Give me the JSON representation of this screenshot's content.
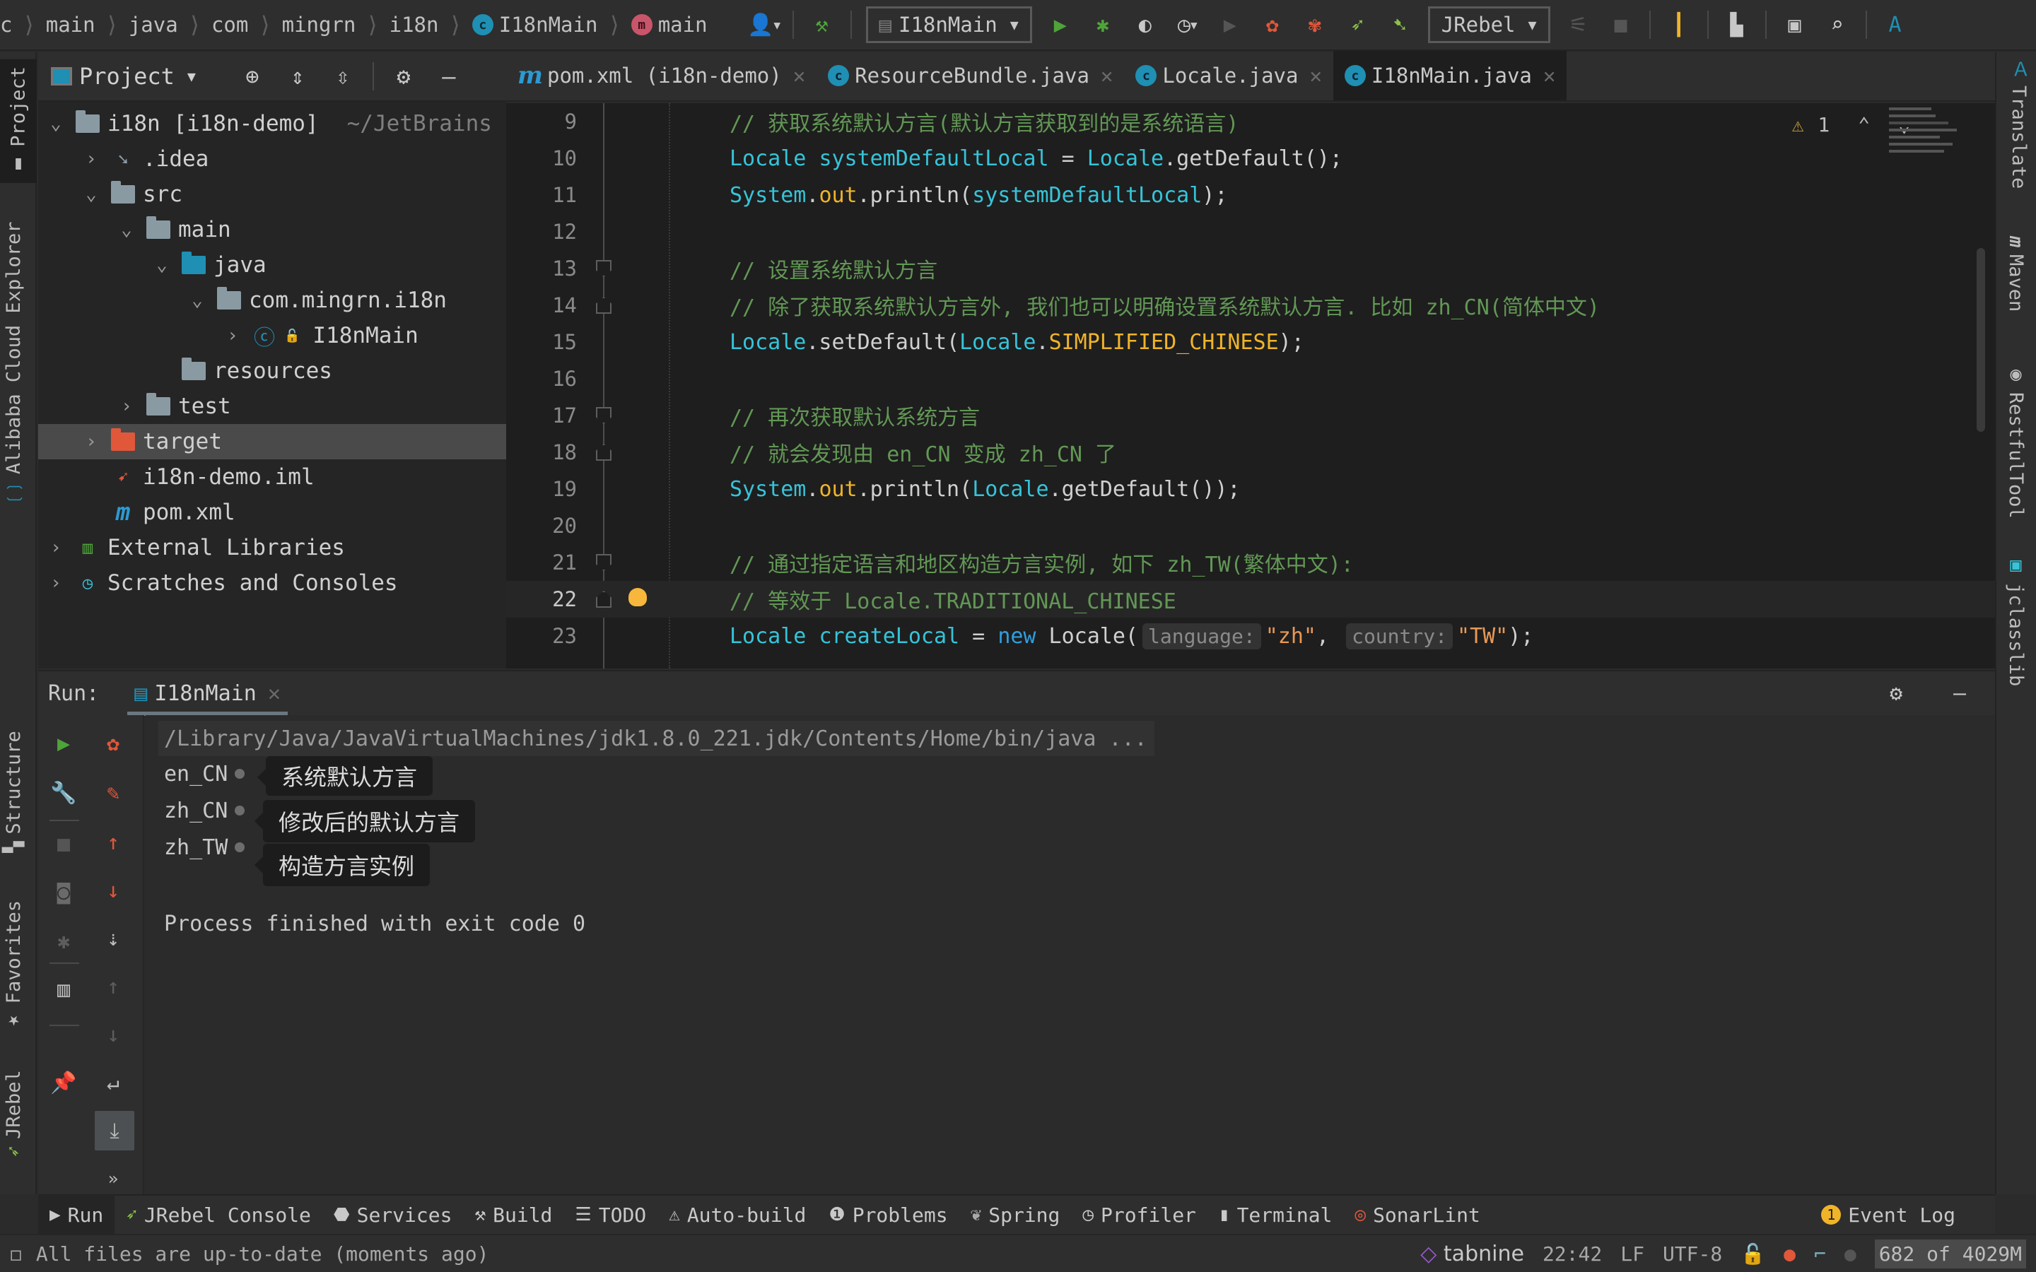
{
  "navbar": {
    "breadcrumbs": [
      "c",
      "main",
      "java",
      "com",
      "mingrn",
      "i18n",
      "I18nMain",
      "main"
    ],
    "run_config": "I18nMain",
    "jrebel_config": "JRebel",
    "icons": [
      "user-icon",
      "hammer-build-icon",
      "run-icon",
      "debug-icon",
      "coverage-icon",
      "profile-icon",
      "run-disabled-icon",
      "jrebel-run-icon",
      "jrebel-debug-icon",
      "jrebel-rocket-run-icon",
      "jrebel-rocket-debug-icon",
      "stop-icon",
      "vcs-update-icon",
      "project-structure-icon",
      "run-anything-icon",
      "search-icon",
      "translate-icon"
    ]
  },
  "left_strip": {
    "tabs": [
      {
        "label": "Project",
        "icon": "folder-icon",
        "active": true
      },
      {
        "label": "Alibaba Cloud Explorer",
        "icon": "alibaba-cloud-icon"
      },
      {
        "label": "Structure",
        "icon": "structure-icon"
      },
      {
        "label": "Favorites",
        "icon": "star-icon"
      },
      {
        "label": "JRebel",
        "icon": "jrebel-icon"
      }
    ]
  },
  "right_strip": {
    "tabs": [
      {
        "label": "Translate",
        "icon": "translate-icon"
      },
      {
        "label": "Maven",
        "icon": "maven-icon"
      },
      {
        "label": "RestfulTool",
        "icon": "restful-icon"
      },
      {
        "label": "jclasslib",
        "icon": "jclasslib-icon"
      }
    ]
  },
  "project": {
    "title": "Project",
    "tree": [
      {
        "label": "i18n [i18n-demo]",
        "hint": "~/JetBrains",
        "depth": 0,
        "expanded": true,
        "icon": "module-folder"
      },
      {
        "label": ".idea",
        "depth": 1,
        "expanded": false,
        "icon": "idea-folder"
      },
      {
        "label": "src",
        "depth": 1,
        "expanded": true,
        "icon": "folder"
      },
      {
        "label": "main",
        "depth": 2,
        "expanded": true,
        "icon": "folder"
      },
      {
        "label": "java",
        "depth": 3,
        "expanded": true,
        "icon": "source-folder"
      },
      {
        "label": "com.mingrn.i18n",
        "depth": 4,
        "expanded": true,
        "icon": "package"
      },
      {
        "label": "I18nMain",
        "depth": 5,
        "expanded": false,
        "icon": "class-main"
      },
      {
        "label": "resources",
        "depth": 3,
        "icon": "resources-folder"
      },
      {
        "label": "test",
        "depth": 2,
        "expanded": false,
        "icon": "folder"
      },
      {
        "label": "target",
        "depth": 1,
        "expanded": false,
        "icon": "excluded-folder",
        "selected": true
      },
      {
        "label": "i18n-demo.iml",
        "depth": 1,
        "icon": "iml-file"
      },
      {
        "label": "pom.xml",
        "depth": 1,
        "icon": "maven-file"
      },
      {
        "label": "External Libraries",
        "depth": 0,
        "expanded": false,
        "icon": "libraries"
      },
      {
        "label": "Scratches and Consoles",
        "depth": 0,
        "expanded": false,
        "icon": "scratches"
      }
    ]
  },
  "editor": {
    "tabs": [
      {
        "label": "pom.xml (i18n-demo)",
        "icon": "maven-icon"
      },
      {
        "label": "ResourceBundle.java",
        "icon": "class-icon"
      },
      {
        "label": "Locale.java",
        "icon": "class-icon"
      },
      {
        "label": "I18nMain.java",
        "icon": "class-main-icon",
        "active": true
      }
    ],
    "inspection": {
      "warnings": "1"
    },
    "current_line": 22,
    "lines": [
      {
        "n": "9",
        "tokens": [
          [
            "c-comment",
            "// 获取系统默认方言(默认方言获取到的是系统语言)"
          ]
        ]
      },
      {
        "n": "10",
        "tokens": [
          [
            "c-type",
            "Locale"
          ],
          [
            "c-plain",
            " "
          ],
          [
            "c-var",
            "systemDefaultLocal"
          ],
          [
            "c-plain",
            " = "
          ],
          [
            "c-type",
            "Locale"
          ],
          [
            "c-plain",
            ".getDefault();"
          ]
        ]
      },
      {
        "n": "11",
        "tokens": [
          [
            "c-type",
            "System"
          ],
          [
            "c-plain",
            "."
          ],
          [
            "c-field",
            "out"
          ],
          [
            "c-plain",
            ".println("
          ],
          [
            "c-var",
            "systemDefaultLocal"
          ],
          [
            "c-plain",
            ");"
          ]
        ]
      },
      {
        "n": "12",
        "tokens": []
      },
      {
        "n": "13",
        "tokens": [
          [
            "c-comment",
            "// 设置系统默认方言"
          ]
        ],
        "fold": "start"
      },
      {
        "n": "14",
        "tokens": [
          [
            "c-comment",
            "// 除了获取系统默认方言外, 我们也可以明确设置系统默认方言. 比如 zh_CN(简体中文)"
          ]
        ],
        "fold": "end"
      },
      {
        "n": "15",
        "tokens": [
          [
            "c-type",
            "Locale"
          ],
          [
            "c-plain",
            ".setDefault("
          ],
          [
            "c-type",
            "Locale"
          ],
          [
            "c-plain",
            "."
          ],
          [
            "c-field",
            "SIMPLIFIED_CHINESE"
          ],
          [
            "c-plain",
            ");"
          ]
        ]
      },
      {
        "n": "16",
        "tokens": []
      },
      {
        "n": "17",
        "tokens": [
          [
            "c-comment",
            "// 再次获取默认系统方言"
          ]
        ],
        "fold": "start"
      },
      {
        "n": "18",
        "tokens": [
          [
            "c-comment",
            "// 就会发现由 en_CN 变成 zh_CN 了"
          ]
        ],
        "fold": "end"
      },
      {
        "n": "19",
        "tokens": [
          [
            "c-type",
            "System"
          ],
          [
            "c-plain",
            "."
          ],
          [
            "c-field",
            "out"
          ],
          [
            "c-plain",
            ".println("
          ],
          [
            "c-type",
            "Locale"
          ],
          [
            "c-plain",
            ".getDefault());"
          ]
        ]
      },
      {
        "n": "20",
        "tokens": []
      },
      {
        "n": "21",
        "tokens": [
          [
            "c-comment",
            "// 通过指定语言和地区构造方言实例, 如下 zh_TW(繁体中文):"
          ]
        ],
        "fold": "start"
      },
      {
        "n": "22",
        "tokens": [
          [
            "c-comment",
            "// 等效于 Locale.TRADITIONAL_CHINESE"
          ]
        ],
        "fold": "end",
        "bulb": true
      },
      {
        "n": "23",
        "tokens": [
          [
            "c-type",
            "Locale"
          ],
          [
            "c-plain",
            " "
          ],
          [
            "c-var",
            "createLocal"
          ],
          [
            "c-plain",
            " = "
          ],
          [
            "c-kw",
            "new"
          ],
          [
            "c-plain",
            " Locale("
          ],
          [
            "hint",
            "language:"
          ],
          [
            "c-str",
            "\"zh\""
          ],
          [
            "c-plain",
            ", "
          ],
          [
            "hint",
            "country:"
          ],
          [
            "c-str",
            "\"TW\""
          ],
          [
            "c-plain",
            ");"
          ]
        ]
      }
    ]
  },
  "run": {
    "label": "Run:",
    "tab": "I18nMain",
    "command": "/Library/Java/JavaVirtualMachines/jdk1.8.0_221.jdk/Contents/Home/bin/java ...",
    "output": [
      {
        "text": "en_CN",
        "note": "系统默认方言"
      },
      {
        "text": "zh_CN",
        "note": "修改后的默认方言"
      },
      {
        "text": "zh_TW",
        "note": "构造方言实例"
      }
    ],
    "finish": "Process finished with exit code 0"
  },
  "bottom_tabs": [
    {
      "label": "Run",
      "icon": "run-icon",
      "active": true
    },
    {
      "label": "JRebel Console",
      "icon": "jrebel-icon"
    },
    {
      "label": "Services",
      "icon": "services-icon"
    },
    {
      "label": "Build",
      "icon": "hammer-icon"
    },
    {
      "label": "TODO",
      "icon": "list-icon"
    },
    {
      "label": "Auto-build",
      "icon": "warning-icon"
    },
    {
      "label": "Problems",
      "icon": "problems-icon"
    },
    {
      "label": "Spring",
      "icon": "spring-icon"
    },
    {
      "label": "Profiler",
      "icon": "profiler-icon"
    },
    {
      "label": "Terminal",
      "icon": "terminal-icon"
    },
    {
      "label": "SonarLint",
      "icon": "sonarlint-icon"
    }
  ],
  "event_log": {
    "label": "Event Log",
    "count": "1"
  },
  "status": {
    "message": "All files are up-to-date (moments ago)",
    "tabnine": "tabnine",
    "position": "22:42",
    "line_sep": "LF",
    "encoding": "UTF-8",
    "memory": "682 of 4029M"
  },
  "colors": {
    "accent_green": "#4fa33a",
    "accent_red": "#e0573a",
    "accent_teal": "#1f8fb3",
    "warning_yellow": "#f6b73c"
  }
}
